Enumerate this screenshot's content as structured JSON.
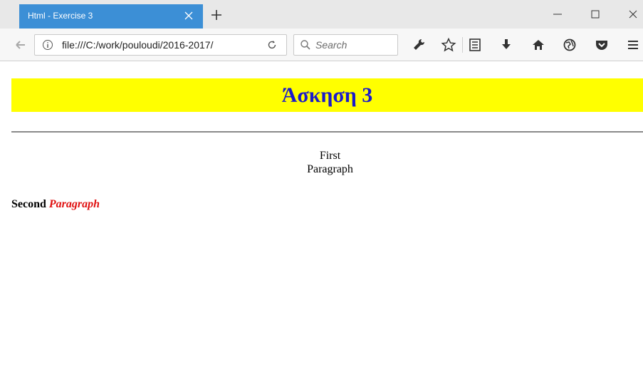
{
  "window": {
    "tab_title": "Html - Exercise 3"
  },
  "toolbar": {
    "url": "file:///C:/work/pouloudi/2016-2017/",
    "search_placeholder": "Search"
  },
  "page": {
    "heading": "Άσκηση 3",
    "paragraph1_line1": "First",
    "paragraph1_line2": "Paragraph",
    "paragraph2_bold": "Second",
    "paragraph2_italic": "Paragraph"
  },
  "icons": {
    "tab_close": "close-icon",
    "new_tab": "plus-icon",
    "minimize": "minimize-icon",
    "maximize": "maximize-icon",
    "close_window": "close-icon",
    "back": "back-arrow-icon",
    "info": "info-icon",
    "reload": "reload-icon",
    "search": "search-icon",
    "tools": "wrench-icon",
    "bookmark": "star-icon",
    "library": "library-icon",
    "downloads": "download-icon",
    "home": "home-icon",
    "extension": "globe-icon",
    "pocket": "pocket-icon",
    "menu": "hamburger-menu-icon"
  },
  "colors": {
    "tab_active": "#3c8fd6",
    "heading_background": "#ffff00",
    "heading_text": "#1a1acc",
    "italic_text": "#e01010"
  }
}
